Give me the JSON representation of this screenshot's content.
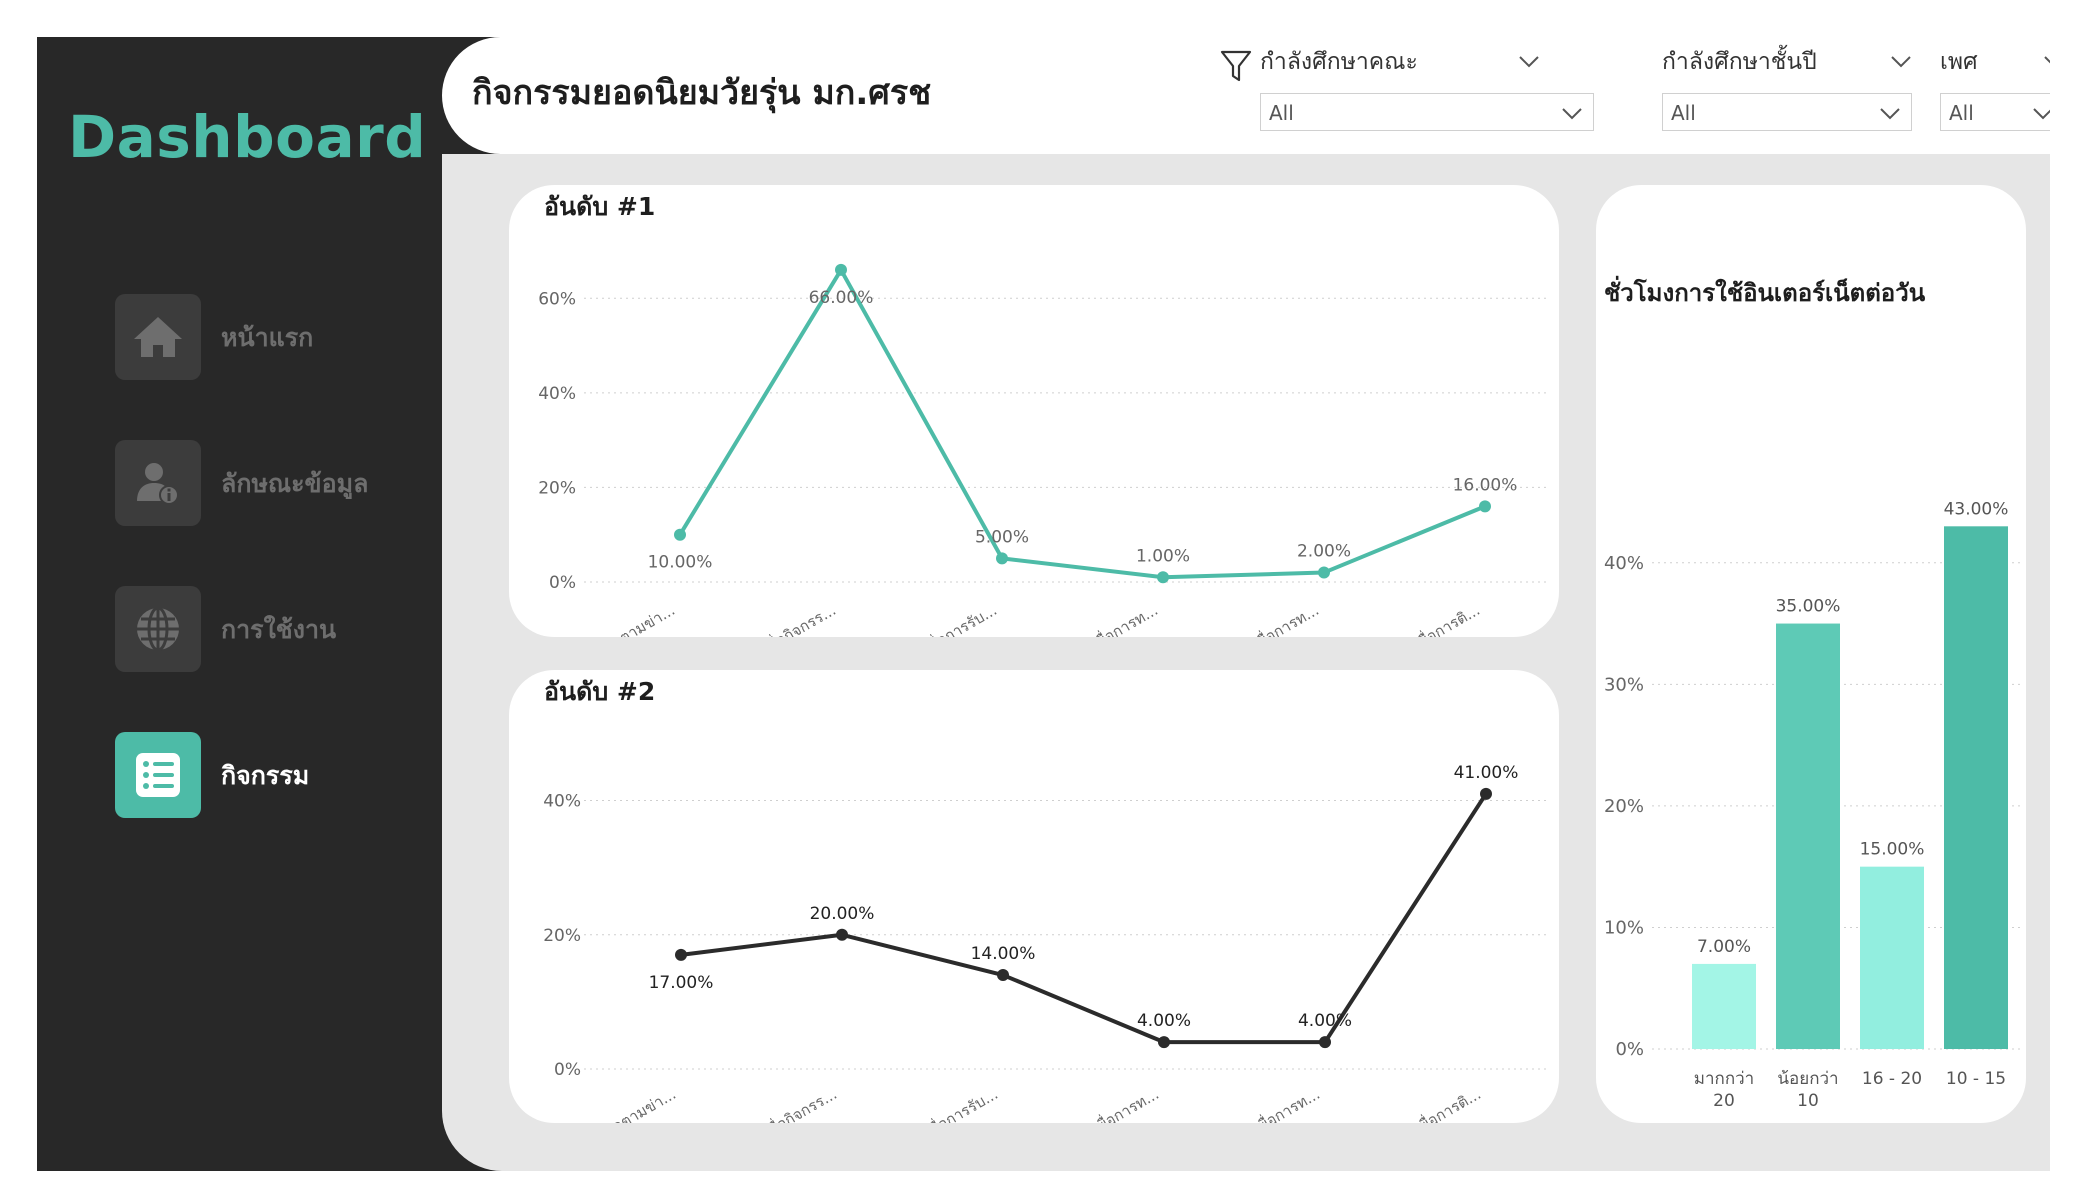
{
  "sidebar": {
    "brand": "Dashboard",
    "items": [
      {
        "label": "หน้าแรก",
        "icon": "home-icon",
        "active": false
      },
      {
        "label": "ลักษณะข้อมูล",
        "icon": "user-info-icon",
        "active": false
      },
      {
        "label": "การใช้งาน",
        "icon": "globe-icon",
        "active": false
      },
      {
        "label": "กิจกรรม",
        "icon": "list-icon",
        "active": true
      }
    ]
  },
  "header": {
    "title": "กิจกรรมยอดนิยมวัยรุ่น มก.ศรช",
    "filter_icon": "filter-icon",
    "slicers": [
      {
        "label": "กำลังศึกษาคณะ",
        "value": "All"
      },
      {
        "label": "กำลังศึกษาชั้นปี",
        "value": "All"
      },
      {
        "label": "เพศ",
        "value": "All"
      }
    ]
  },
  "colors": {
    "accent": "#4dbba7",
    "sidebar_bg": "#282828",
    "canvas_bg": "#e6e6e6",
    "line2": "#2b2b2b",
    "bar_light": "#a3f5e6",
    "bar_mid": "#5ecab6",
    "bar_pale": "#92eedf",
    "bar_dark": "#4dbba7"
  },
  "chart_data": [
    {
      "type": "line",
      "title": "อันดับ #1",
      "categories": [
        "ติดตามข่า...",
        "เพื่อกิจกรร...",
        "เพื่อการรับ...",
        "เพื่อการท...",
        "เพื่อการท...",
        "เพื่อการติ..."
      ],
      "values": [
        10,
        66,
        5,
        1,
        2,
        16
      ],
      "data_labels": [
        "10.00%",
        "66.00%",
        "5.00%",
        "1.00%",
        "2.00%",
        "16.00%"
      ],
      "y_ticks": [
        0,
        20,
        40,
        60
      ],
      "y_tick_labels": [
        "0%",
        "20%",
        "40%",
        "60%"
      ],
      "ylim": [
        0,
        70
      ],
      "grid": true
    },
    {
      "type": "line",
      "title": "อันดับ #2",
      "categories": [
        "ติดตามข่า...",
        "เพื่อกิจกรร...",
        "เพื่อการรับ...",
        "เพื่อการท...",
        "เพื่อการท...",
        "เพื่อการติ..."
      ],
      "values": [
        17,
        20,
        14,
        4,
        4,
        41
      ],
      "data_labels": [
        "17.00%",
        "20.00%",
        "14.00%",
        "4.00%",
        "4.00%",
        "41.00%"
      ],
      "y_ticks": [
        0,
        20,
        40
      ],
      "y_tick_labels": [
        "0%",
        "20%",
        "40%"
      ],
      "ylim": [
        0,
        45
      ],
      "grid": true
    },
    {
      "type": "bar",
      "title": "ชั่วโมงการใช้อินเตอร์เน็ตต่อวัน",
      "categories": [
        [
          "มากกว่า",
          "20"
        ],
        [
          "น้อยกว่า",
          "10"
        ],
        [
          "16 - 20"
        ],
        [
          "10 - 15"
        ]
      ],
      "values": [
        7,
        35,
        15,
        43
      ],
      "data_labels": [
        "7.00%",
        "35.00%",
        "15.00%",
        "43.00%"
      ],
      "y_ticks": [
        0,
        10,
        20,
        30,
        40
      ],
      "y_tick_labels": [
        "0%",
        "10%",
        "20%",
        "30%",
        "40%"
      ],
      "ylim": [
        0,
        45
      ],
      "grid": true
    }
  ]
}
